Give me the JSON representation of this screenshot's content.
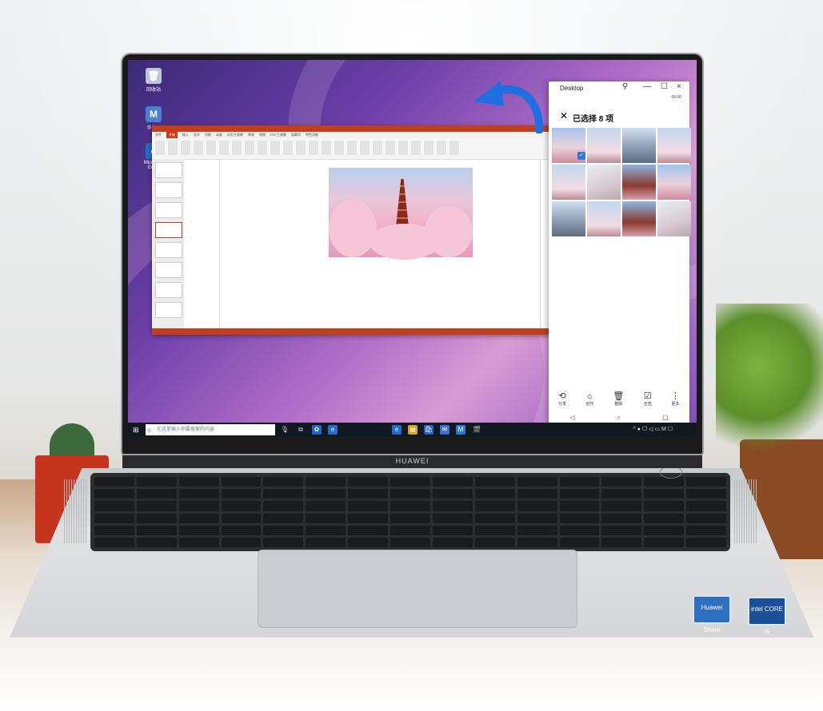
{
  "brand": "HUAWEI",
  "desktop_icons": [
    {
      "name": "recycle-bin-icon",
      "label": "回收站",
      "glyph": "🗑"
    },
    {
      "name": "multiscreen-icon",
      "label": "华为...",
      "glyph": "M"
    },
    {
      "name": "edge-icon",
      "label": "Microsoft Edge",
      "glyph": "e"
    }
  ],
  "powerpoint": {
    "tabs": [
      "文件",
      "开始",
      "插入",
      "设计",
      "切换",
      "动画",
      "幻灯片放映",
      "审阅",
      "视图",
      "PDF工具集",
      "加载项",
      "特色功能"
    ],
    "active_tab": "开始"
  },
  "phone_window": {
    "title": "Desktop",
    "status": "00:00",
    "header": "已选择 8 项",
    "actions": [
      "分享",
      "创作",
      "删除",
      "全选",
      "更多"
    ]
  },
  "taskbar": {
    "search_placeholder": "在这里输入你要搜索的内容"
  },
  "stickers": [
    "Huawei Share",
    "intel CORE i5"
  ],
  "colors": {
    "ppt_accent": "#c43e1c",
    "check_blue": "#2a7ae2",
    "arrow_blue": "#1e6fe0"
  }
}
